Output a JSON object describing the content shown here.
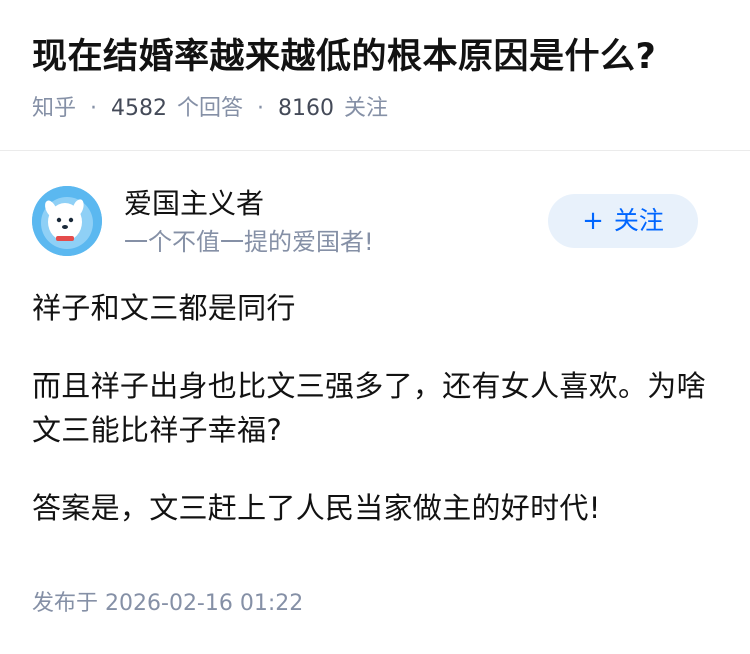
{
  "question": {
    "title": "现在结婚率越来越低的根本原因是什么?",
    "source": "知乎",
    "answer_count": "4582",
    "answer_unit": "个回答",
    "follower_count": "8160",
    "follower_unit": "关注",
    "separator": "·"
  },
  "author": {
    "name": "爱国主义者",
    "bio": "一个不值一提的爱国者!",
    "avatar_icon": "dog-avatar-icon",
    "follow_plus": "+",
    "follow_label": "关注"
  },
  "answer": {
    "paragraphs": [
      "祥子和文三都是同行",
      "而且祥子出身也比文三强多了，还有女人喜欢。为啥文三能比祥子幸福?",
      "答案是，文三赶上了人民当家做主的好时代!"
    ],
    "publish_prefix": "发布于",
    "publish_time": "2026-02-16 01:22"
  },
  "colors": {
    "title": "#121212",
    "meta": "#8590a6",
    "accent": "#0066ff",
    "follow_bg": "#e8f1fb",
    "avatar_bg": "#5bb8f0"
  }
}
